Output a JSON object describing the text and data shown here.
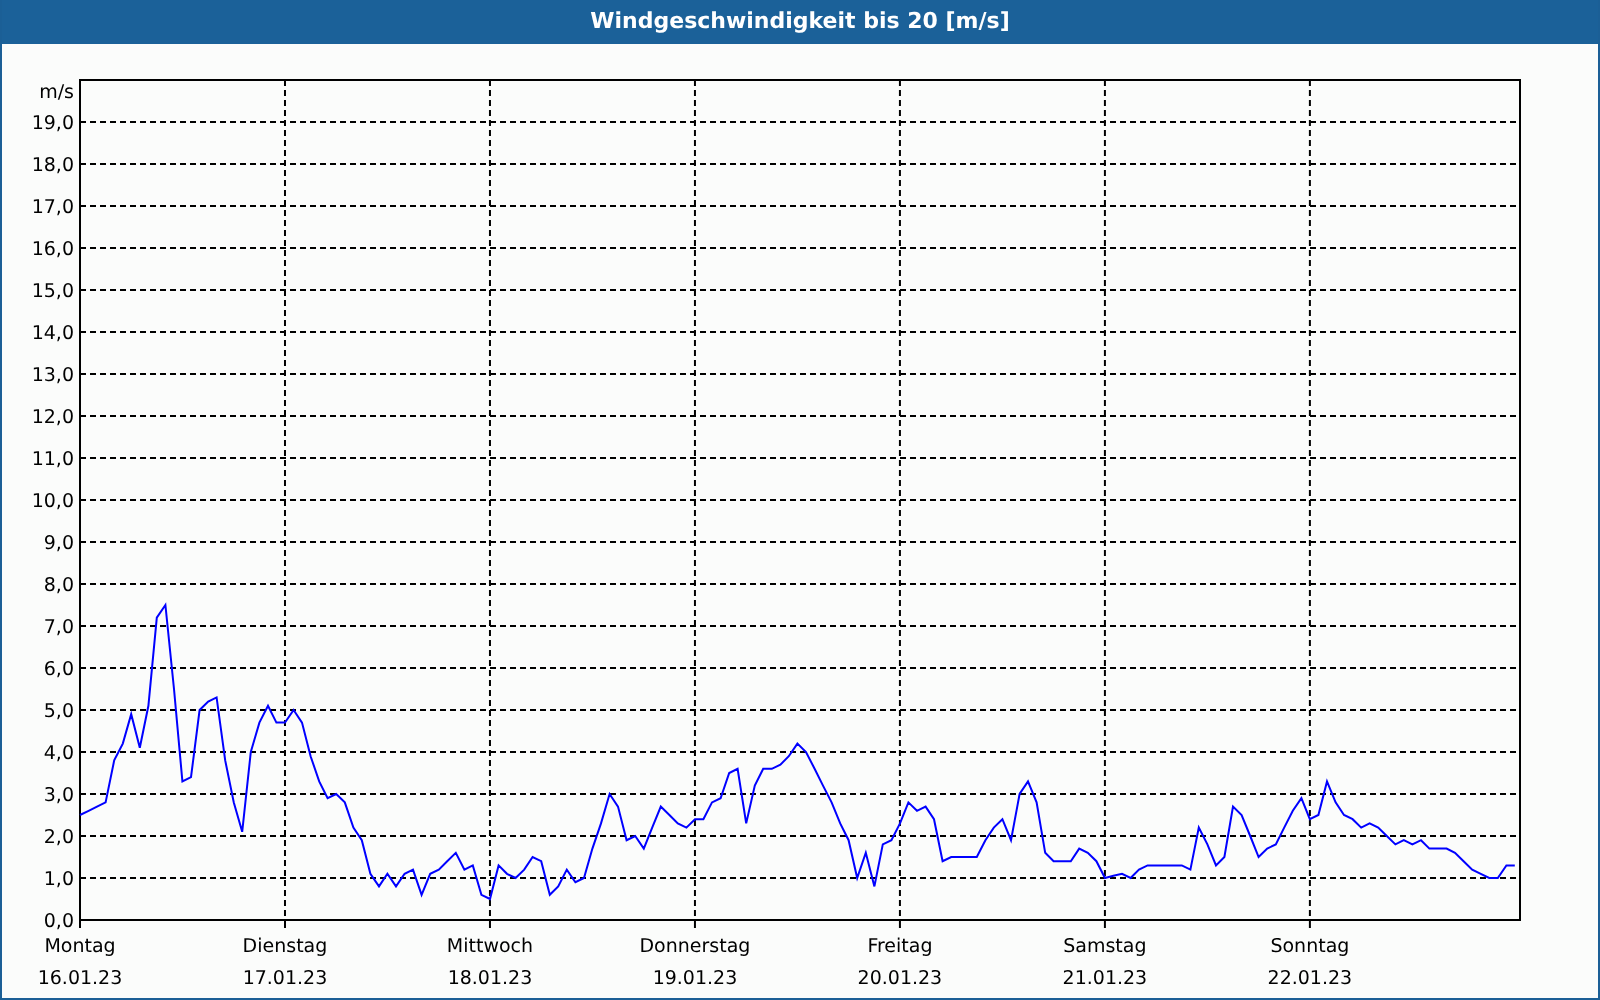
{
  "window": {
    "title": "Windgeschwindigkeit bis 20 [m/s]"
  },
  "chart": {
    "chart_data": {
      "type": "line",
      "ylabel": "m/s",
      "grid": true,
      "ylim": [
        0,
        20
      ],
      "categories": [
        "Montag\n16.01.23",
        null,
        null,
        null,
        null,
        null,
        null,
        null,
        null,
        null,
        null,
        null,
        null,
        null,
        null,
        null,
        null,
        null,
        null,
        null,
        null,
        null,
        null,
        null,
        "Dienstag\n17.01.23",
        null,
        null,
        null,
        null,
        null,
        null,
        null,
        null,
        null,
        null,
        null,
        null,
        null,
        null,
        null,
        null,
        null,
        null,
        null,
        null,
        null,
        null,
        null,
        "Mittwoch\n18.01.23",
        null,
        null,
        null,
        null,
        null,
        null,
        null,
        null,
        null,
        null,
        null,
        null,
        null,
        null,
        null,
        null,
        null,
        null,
        null,
        null,
        null,
        null,
        null,
        "Donnerstag\n19.01.23",
        null,
        null,
        null,
        null,
        null,
        null,
        null,
        null,
        null,
        null,
        null,
        null,
        null,
        null,
        null,
        null,
        null,
        null,
        null,
        null,
        null,
        null,
        null,
        "Freitag\n20.01.23",
        null,
        null,
        null,
        null,
        null,
        null,
        null,
        null,
        null,
        null,
        null,
        null,
        null,
        null,
        null,
        null,
        null,
        null,
        null,
        null,
        null,
        null,
        null,
        "Samstag\n21.01.23",
        null,
        null,
        null,
        null,
        null,
        null,
        null,
        null,
        null,
        null,
        null,
        null,
        null,
        null,
        null,
        null,
        null,
        null,
        null,
        null,
        null,
        null,
        null,
        "Sonntag\n22.01.23",
        null,
        null,
        null,
        null,
        null,
        null,
        null,
        null,
        null,
        null,
        null,
        null,
        null,
        null,
        null,
        null,
        null,
        null,
        null,
        null,
        null,
        null,
        null,
        null
      ],
      "series": [
        {
          "color": "#0000ff",
          "values": [
            2.5,
            2.6,
            2.7,
            2.8,
            3.8,
            4.2,
            4.9,
            4.1,
            5.1,
            7.2,
            7.5,
            5.5,
            3.3,
            3.4,
            5.0,
            5.2,
            5.3,
            3.8,
            2.8,
            2.1,
            4.0,
            4.7,
            5.1,
            4.7,
            4.7,
            5.0,
            4.7,
            3.9,
            3.3,
            2.9,
            3.0,
            2.8,
            2.2,
            1.9,
            1.1,
            0.8,
            1.1,
            0.8,
            1.1,
            1.2,
            0.6,
            1.1,
            1.2,
            1.4,
            1.6,
            1.2,
            1.3,
            0.6,
            0.5,
            1.3,
            1.1,
            1.0,
            1.2,
            1.5,
            1.4,
            0.6,
            0.8,
            1.2,
            0.9,
            1.0,
            1.7,
            2.3,
            3.0,
            2.7,
            1.9,
            2.0,
            1.7,
            2.2,
            2.7,
            2.5,
            2.3,
            2.2,
            2.4,
            2.4,
            2.8,
            2.9,
            3.5,
            3.6,
            2.3,
            3.2,
            3.6,
            3.6,
            3.7,
            3.9,
            4.2,
            4.0,
            3.6,
            3.2,
            2.8,
            2.3,
            1.9,
            1.0,
            1.6,
            0.8,
            1.8,
            1.9,
            2.3,
            2.8,
            2.6,
            2.7,
            2.4,
            1.4,
            1.5,
            1.5,
            1.5,
            1.5,
            1.9,
            2.2,
            2.4,
            1.9,
            3.0,
            3.3,
            2.8,
            1.6,
            1.4,
            1.4,
            1.4,
            1.7,
            1.6,
            1.4,
            1.0,
            1.05,
            1.1,
            1.0,
            1.2,
            1.3,
            1.3,
            1.3,
            1.3,
            1.3,
            1.2,
            2.2,
            1.8,
            1.3,
            1.5,
            2.7,
            2.5,
            2.0,
            1.5,
            1.7,
            1.8,
            2.2,
            2.6,
            2.9,
            2.4,
            2.5,
            3.3,
            2.8,
            2.5,
            2.4,
            2.2,
            2.3,
            2.2,
            2.0,
            1.8,
            1.9,
            1.8,
            1.9,
            1.7,
            1.7,
            1.7,
            1.6,
            1.4,
            1.2,
            1.1,
            1.0,
            1.0,
            1.3,
            1.3
          ]
        }
      ],
      "yticks": [
        {
          "value": 0,
          "label": "0,0"
        },
        {
          "value": 1,
          "label": "1,0"
        },
        {
          "value": 2,
          "label": "2,0"
        },
        {
          "value": 3,
          "label": "3,0"
        },
        {
          "value": 4,
          "label": "4,0"
        },
        {
          "value": 5,
          "label": "5,0"
        },
        {
          "value": 6,
          "label": "6,0"
        },
        {
          "value": 7,
          "label": "7,0"
        },
        {
          "value": 8,
          "label": "8,0"
        },
        {
          "value": 9,
          "label": "9,0"
        },
        {
          "value": 10,
          "label": "10,0"
        },
        {
          "value": 11,
          "label": "11,0"
        },
        {
          "value": 12,
          "label": "12,0"
        },
        {
          "value": 13,
          "label": "13,0"
        },
        {
          "value": 14,
          "label": "14,0"
        },
        {
          "value": 15,
          "label": "15,0"
        },
        {
          "value": 16,
          "label": "16,0"
        },
        {
          "value": 17,
          "label": "17,0"
        },
        {
          "value": 18,
          "label": "18,0"
        },
        {
          "value": 19,
          "label": "19,0"
        }
      ]
    }
  }
}
